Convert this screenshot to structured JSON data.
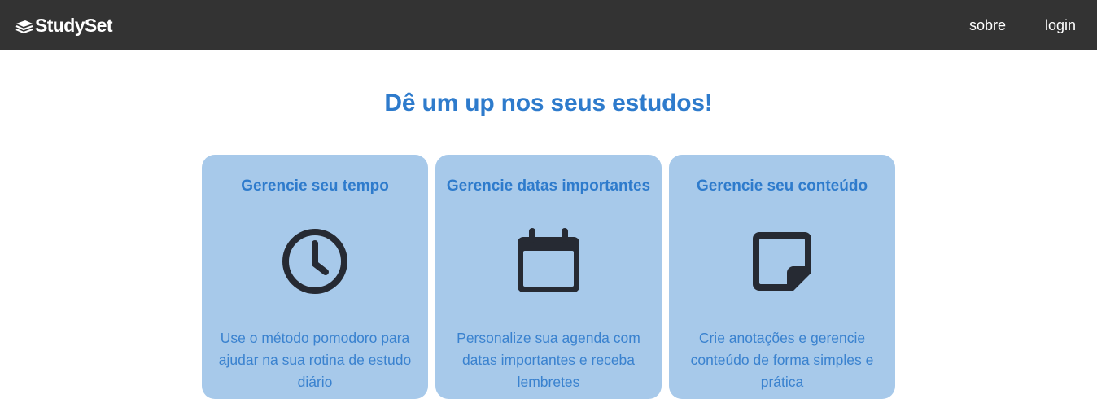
{
  "header": {
    "brand": "StudySet",
    "nav": [
      {
        "label": "sobre"
      },
      {
        "label": "login"
      }
    ]
  },
  "hero": {
    "title": "Dê um up nos seus estudos!"
  },
  "cards": [
    {
      "title": "Gerencie seu tempo",
      "icon": "clock-icon",
      "description": "Use o método pomodoro para ajudar na sua rotina de estudo diário"
    },
    {
      "title": "Gerencie datas importantes",
      "icon": "calendar-icon",
      "description": "Personalize sua agenda com datas importantes e receba lembretes"
    },
    {
      "title": "Gerencie seu conteúdo",
      "icon": "sticky-note-icon",
      "description": "Crie anotações e gerencie conteúdo de forma simples e prática"
    }
  ],
  "colors": {
    "header_bg": "#333333",
    "accent": "#2e7bcc",
    "card_bg": "#a7c9ea",
    "icon": "#262a33"
  }
}
